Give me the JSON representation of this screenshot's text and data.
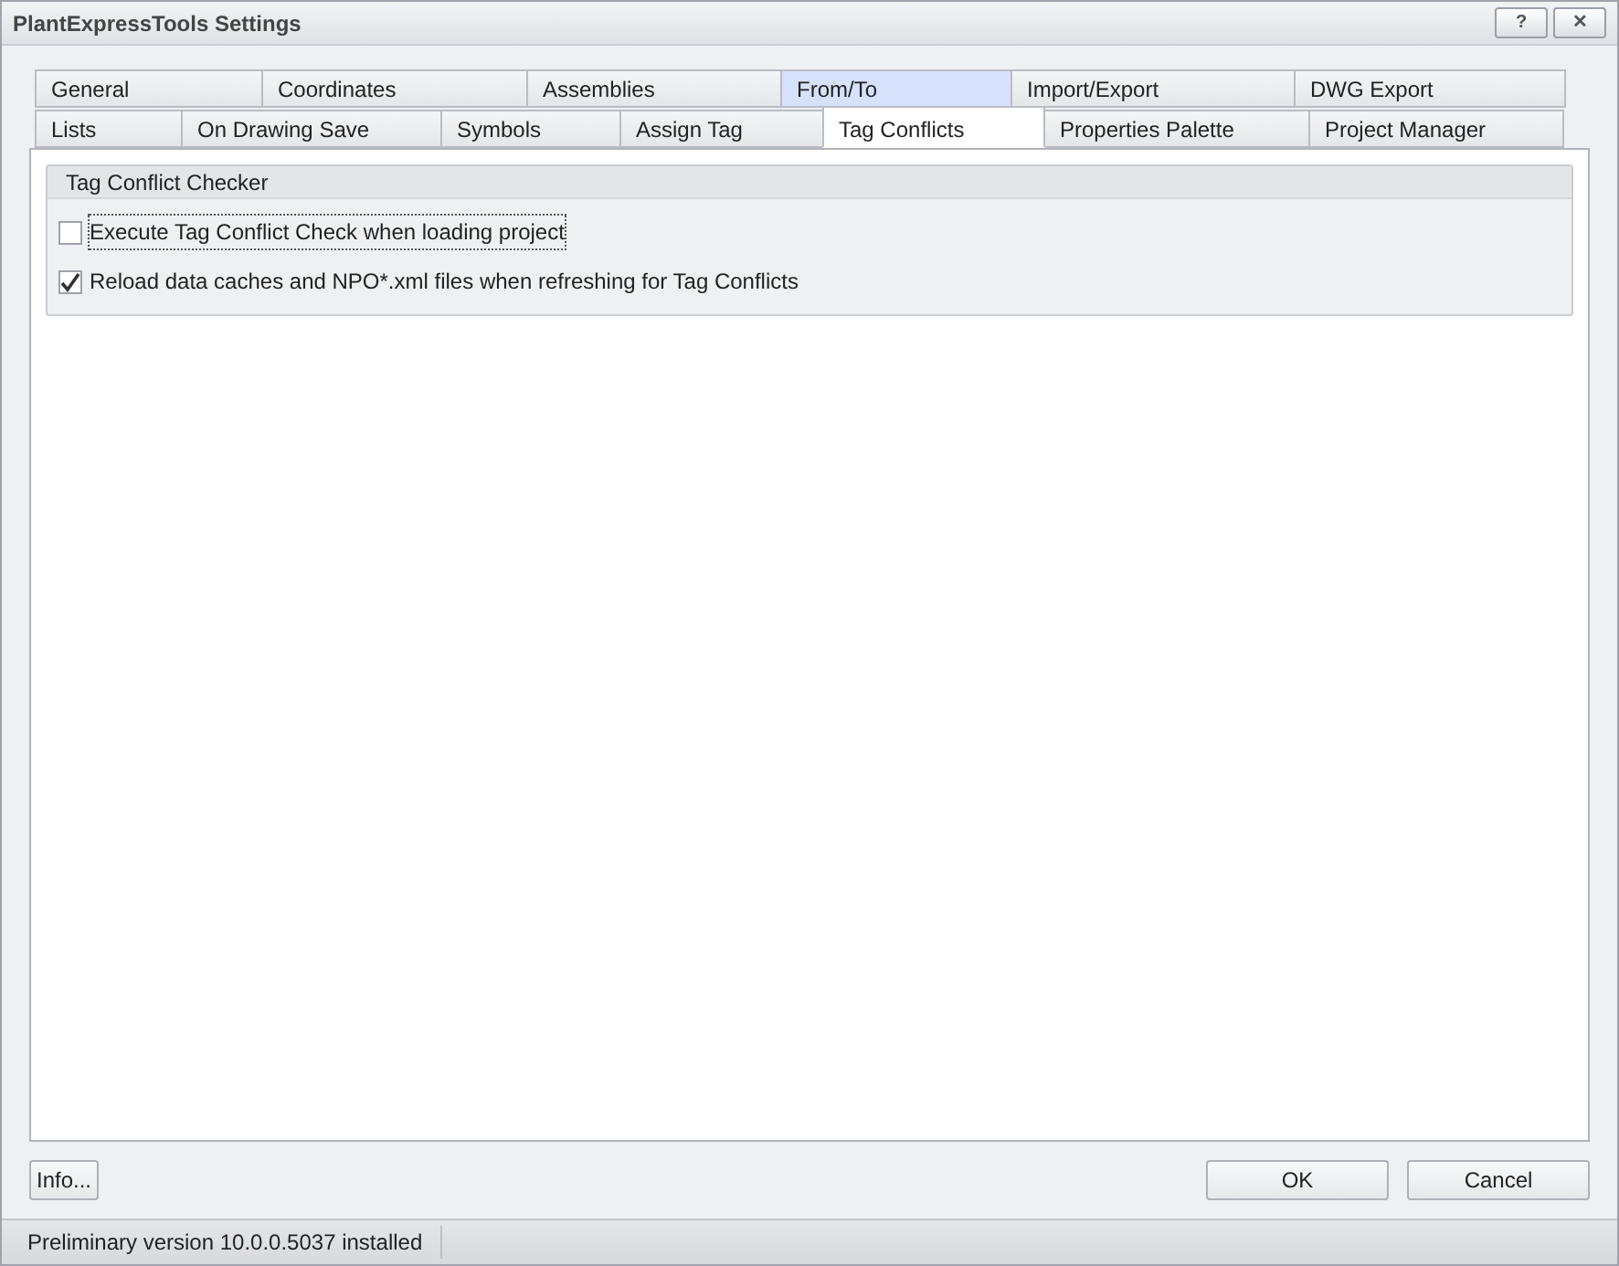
{
  "window": {
    "title": "PlantExpressTools Settings",
    "buttons": [
      "?",
      "✕"
    ]
  },
  "tab_rows": [
    [
      {
        "label": "General",
        "selected": false,
        "highlighted": false
      },
      {
        "label": "Coordinates",
        "selected": false,
        "highlighted": false
      },
      {
        "label": "Assemblies",
        "selected": false,
        "highlighted": false
      },
      {
        "label": "From/To",
        "selected": false,
        "highlighted": true
      },
      {
        "label": "Import/Export",
        "selected": false,
        "highlighted": false
      },
      {
        "label": "DWG Export",
        "selected": false,
        "highlighted": false
      }
    ],
    [
      {
        "label": "Lists",
        "selected": false,
        "highlighted": false
      },
      {
        "label": "On Drawing Save",
        "selected": false,
        "highlighted": false
      },
      {
        "label": "Symbols",
        "selected": false,
        "highlighted": false
      },
      {
        "label": "Assign Tag",
        "selected": false,
        "highlighted": false
      },
      {
        "label": "Tag Conflicts",
        "selected": true,
        "highlighted": false
      },
      {
        "label": "Properties Palette",
        "selected": false,
        "highlighted": false
      },
      {
        "label": "Project Manager",
        "selected": false,
        "highlighted": false
      }
    ]
  ],
  "group": {
    "title": "Tag Conflict Checker",
    "options": [
      {
        "label": "Execute Tag Conflict Check when loading project",
        "checked": false,
        "focused": true
      },
      {
        "label": "Reload data caches and NPO*.xml files when refreshing for Tag Conflicts",
        "checked": true,
        "focused": false
      }
    ]
  },
  "buttons": {
    "info": "Info...",
    "ok": "OK",
    "cancel": "Cancel"
  },
  "status_bar": "Preliminary version 10.0.0.5037 installed"
}
